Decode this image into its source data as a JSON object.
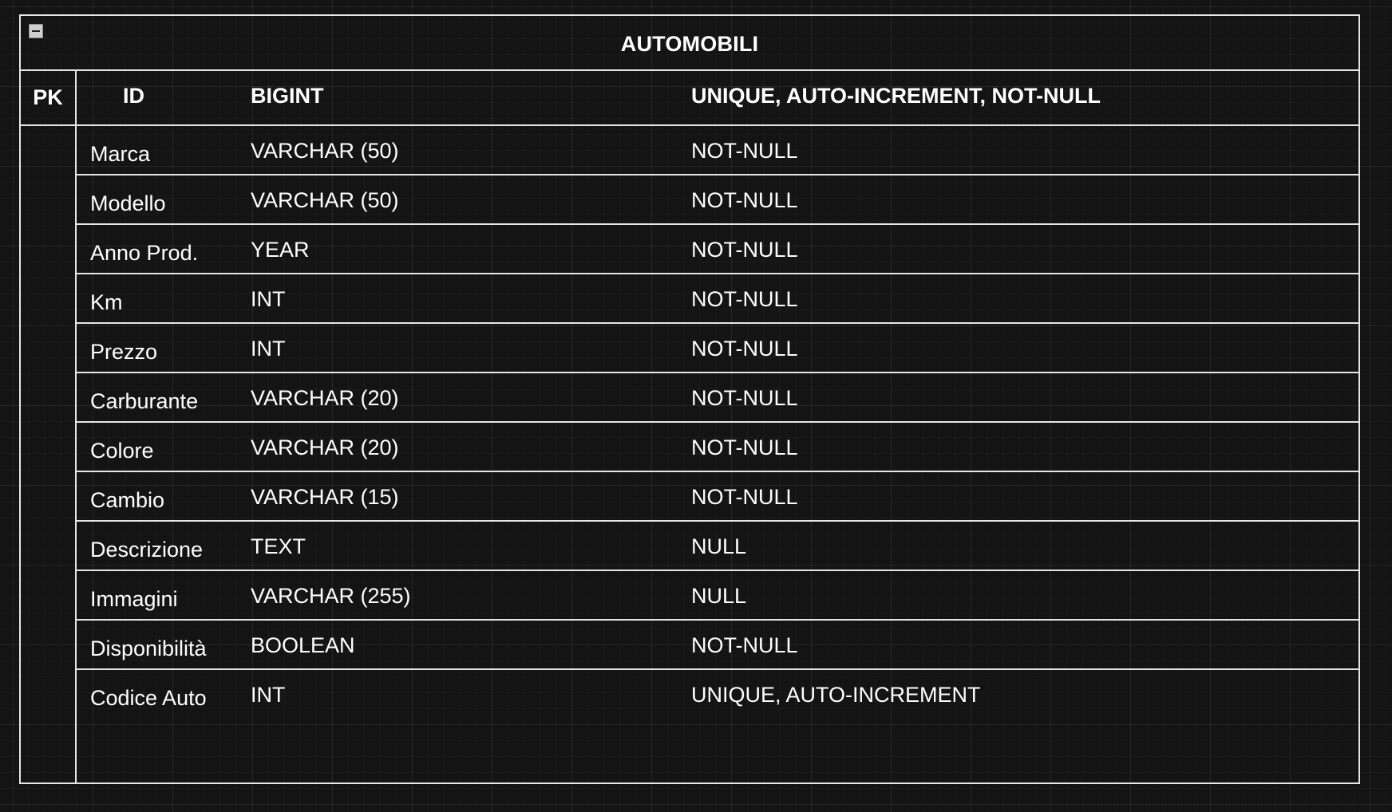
{
  "table": {
    "title": "AUTOMOBILI",
    "primary_key": {
      "key_label": "PK",
      "name": "ID",
      "type": "BIGINT",
      "constraints": "UNIQUE, AUTO-INCREMENT, NOT-NULL"
    },
    "fields": [
      {
        "name": "Marca",
        "type": "VARCHAR (50)",
        "constraints": "NOT-NULL"
      },
      {
        "name": "Modello",
        "type": "VARCHAR (50)",
        "constraints": "NOT-NULL"
      },
      {
        "name": "Anno Prod.",
        "type": "YEAR",
        "constraints": "NOT-NULL"
      },
      {
        "name": "Km",
        "type": "INT",
        "constraints": "NOT-NULL"
      },
      {
        "name": "Prezzo",
        "type": "INT",
        "constraints": "NOT-NULL"
      },
      {
        "name": "Carburante",
        "type": "VARCHAR (20)",
        "constraints": "NOT-NULL"
      },
      {
        "name": "Colore",
        "type": "VARCHAR (20)",
        "constraints": "NOT-NULL"
      },
      {
        "name": "Cambio",
        "type": "VARCHAR (15)",
        "constraints": "NOT-NULL"
      },
      {
        "name": "Descrizione",
        "type": "TEXT",
        "constraints": "NULL"
      },
      {
        "name": "Immagini",
        "type": "VARCHAR (255)",
        "constraints": "NULL"
      },
      {
        "name": "Disponibilità",
        "type": "BOOLEAN",
        "constraints": "NOT-NULL"
      },
      {
        "name": "Codice Auto",
        "type": "INT",
        "constraints": "UNIQUE, AUTO-INCREMENT"
      }
    ]
  },
  "colors": {
    "background": "#141414",
    "line": "#e6e6e6",
    "text": "#ffffff"
  }
}
